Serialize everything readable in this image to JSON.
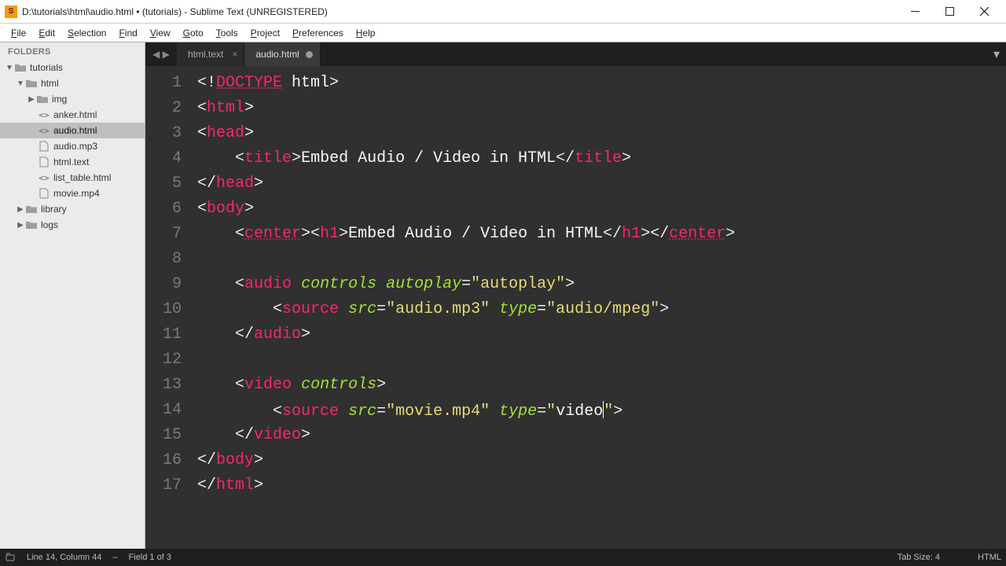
{
  "window": {
    "title": "D:\\tutorials\\html\\audio.html • (tutorials) - Sublime Text (UNREGISTERED)"
  },
  "menu": [
    "File",
    "Edit",
    "Selection",
    "Find",
    "View",
    "Goto",
    "Tools",
    "Project",
    "Preferences",
    "Help"
  ],
  "sidebar": {
    "header": "FOLDERS",
    "tree": [
      {
        "depth": 0,
        "type": "folder",
        "open": true,
        "label": "tutorials"
      },
      {
        "depth": 1,
        "type": "folder",
        "open": true,
        "label": "html"
      },
      {
        "depth": 2,
        "type": "folder",
        "open": false,
        "label": "img"
      },
      {
        "depth": 2,
        "type": "code",
        "label": "anker.html"
      },
      {
        "depth": 2,
        "type": "code",
        "label": "audio.html",
        "selected": true
      },
      {
        "depth": 2,
        "type": "file",
        "label": "audio.mp3"
      },
      {
        "depth": 2,
        "type": "file",
        "label": "html.text"
      },
      {
        "depth": 2,
        "type": "code",
        "label": "list_table.html"
      },
      {
        "depth": 2,
        "type": "file",
        "label": "movie.mp4"
      },
      {
        "depth": 1,
        "type": "folder",
        "open": false,
        "label": "library"
      },
      {
        "depth": 1,
        "type": "folder",
        "open": false,
        "label": "logs"
      }
    ]
  },
  "tabs": [
    {
      "label": "html.text",
      "active": false,
      "dirty": false
    },
    {
      "label": "audio.html",
      "active": true,
      "dirty": true
    }
  ],
  "code": {
    "lines": [
      [
        [
          "punc",
          "<!"
        ],
        [
          "doctype",
          "DOCTYPE"
        ],
        [
          "text",
          " html"
        ],
        [
          "punc",
          ">"
        ]
      ],
      [
        [
          "punc",
          "<"
        ],
        [
          "tag",
          "html"
        ],
        [
          "punc",
          ">"
        ]
      ],
      [
        [
          "punc",
          "<"
        ],
        [
          "tag",
          "head"
        ],
        [
          "punc",
          ">"
        ]
      ],
      [
        [
          "text",
          "    "
        ],
        [
          "punc",
          "<"
        ],
        [
          "tag",
          "title"
        ],
        [
          "punc",
          ">"
        ],
        [
          "text",
          "Embed Audio / Video in HTML"
        ],
        [
          "punc",
          "</"
        ],
        [
          "tag",
          "title"
        ],
        [
          "punc",
          ">"
        ]
      ],
      [
        [
          "punc",
          "</"
        ],
        [
          "tag",
          "head"
        ],
        [
          "punc",
          ">"
        ]
      ],
      [
        [
          "punc",
          "<"
        ],
        [
          "tag",
          "body"
        ],
        [
          "punc",
          ">"
        ]
      ],
      [
        [
          "text",
          "    "
        ],
        [
          "punc",
          "<"
        ],
        [
          "tag-u",
          "center"
        ],
        [
          "punc",
          "><"
        ],
        [
          "tag",
          "h1"
        ],
        [
          "punc",
          ">"
        ],
        [
          "text",
          "Embed Audio / Video in HTML"
        ],
        [
          "punc",
          "</"
        ],
        [
          "tag",
          "h1"
        ],
        [
          "punc",
          "></"
        ],
        [
          "tag-u",
          "center"
        ],
        [
          "punc",
          ">"
        ]
      ],
      [],
      [
        [
          "text",
          "    "
        ],
        [
          "punc",
          "<"
        ],
        [
          "tag",
          "audio"
        ],
        [
          "text",
          " "
        ],
        [
          "attr",
          "controls"
        ],
        [
          "text",
          " "
        ],
        [
          "attr",
          "autoplay"
        ],
        [
          "punc",
          "="
        ],
        [
          "str",
          "\"autoplay\""
        ],
        [
          "punc",
          ">"
        ]
      ],
      [
        [
          "text",
          "        "
        ],
        [
          "punc",
          "<"
        ],
        [
          "tag",
          "source"
        ],
        [
          "text",
          " "
        ],
        [
          "attr",
          "src"
        ],
        [
          "punc",
          "="
        ],
        [
          "str",
          "\"audio.mp3\""
        ],
        [
          "text",
          " "
        ],
        [
          "attr",
          "type"
        ],
        [
          "punc",
          "="
        ],
        [
          "str",
          "\"audio/mpeg\""
        ],
        [
          "punc",
          ">"
        ]
      ],
      [
        [
          "text",
          "    "
        ],
        [
          "punc",
          "</"
        ],
        [
          "tag",
          "audio"
        ],
        [
          "punc",
          ">"
        ]
      ],
      [],
      [
        [
          "text",
          "    "
        ],
        [
          "punc",
          "<"
        ],
        [
          "tag",
          "video"
        ],
        [
          "text",
          " "
        ],
        [
          "attr",
          "controls"
        ],
        [
          "punc",
          ">"
        ]
      ],
      [
        [
          "text",
          "        "
        ],
        [
          "punc",
          "<"
        ],
        [
          "tag",
          "source"
        ],
        [
          "text",
          " "
        ],
        [
          "attr",
          "src"
        ],
        [
          "punc",
          "="
        ],
        [
          "str",
          "\"movie.mp4\""
        ],
        [
          "text",
          " "
        ],
        [
          "attr",
          "type"
        ],
        [
          "punc",
          "="
        ],
        [
          "str",
          "\""
        ],
        [
          "text",
          "video"
        ],
        [
          "caret",
          ""
        ],
        [
          "str",
          "\""
        ],
        [
          "punc",
          ">"
        ]
      ],
      [
        [
          "text",
          "    "
        ],
        [
          "punc",
          "</"
        ],
        [
          "tag",
          "video"
        ],
        [
          "punc",
          ">"
        ]
      ],
      [
        [
          "punc",
          "</"
        ],
        [
          "tag",
          "body"
        ],
        [
          "punc",
          ">"
        ]
      ],
      [
        [
          "punc",
          "</"
        ],
        [
          "tag",
          "html"
        ],
        [
          "punc",
          ">"
        ]
      ]
    ]
  },
  "status": {
    "position": "Line 14, Column 44",
    "field": "Field 1 of 3",
    "tabsize": "Tab Size: 4",
    "syntax": "HTML"
  }
}
